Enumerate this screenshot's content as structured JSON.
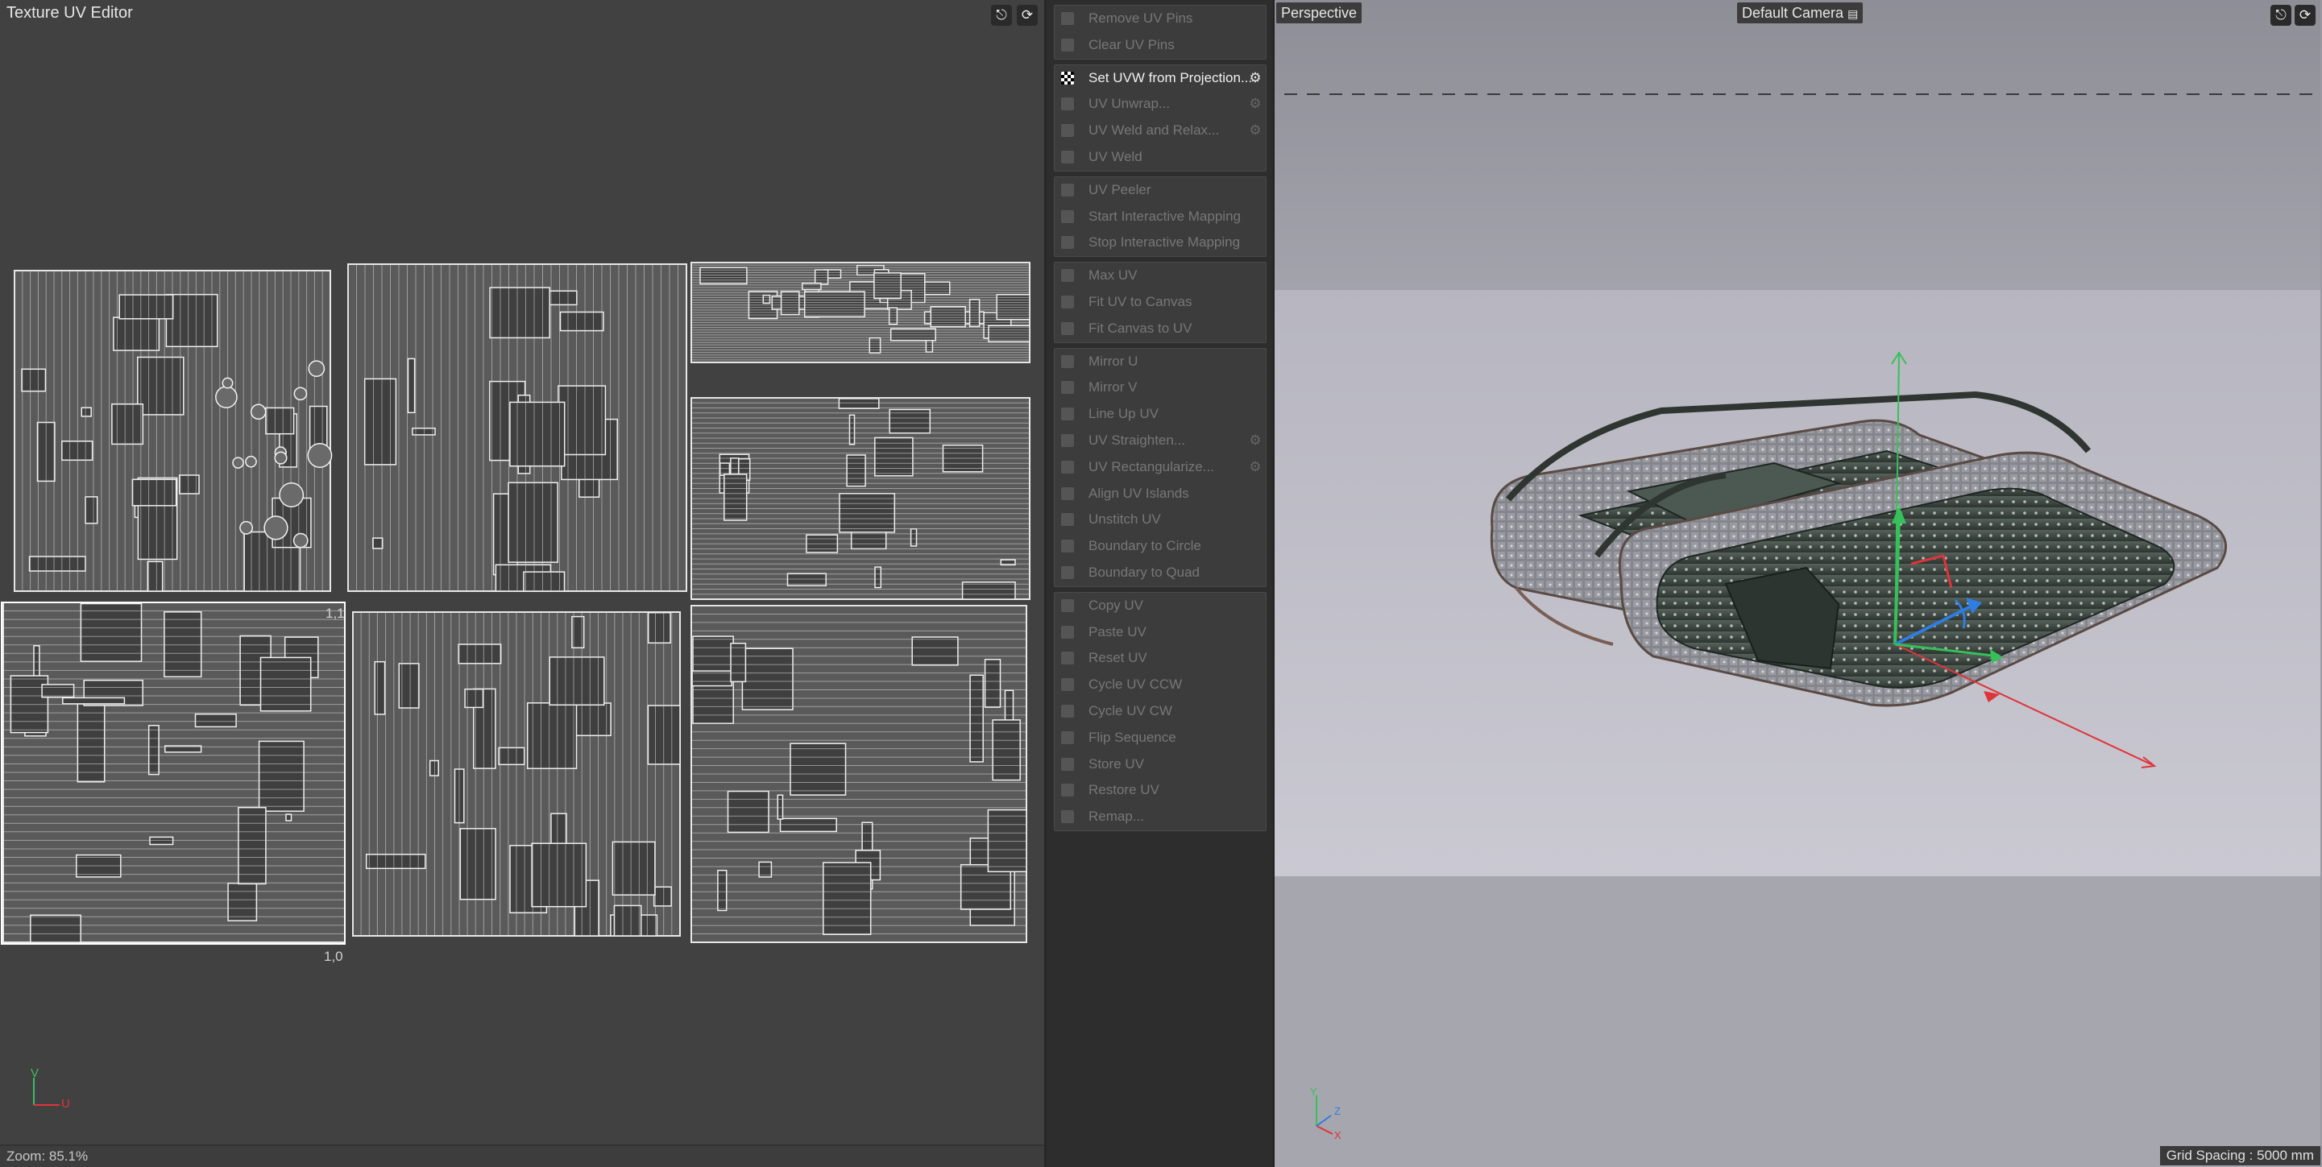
{
  "uv_editor": {
    "title": "Texture UV Editor",
    "tile_label_top": "1,1",
    "tile_label_bottom": "1,0",
    "axis_v": "V",
    "axis_u": "U",
    "zoom": "Zoom: 85.1%",
    "icons": [
      "microphone-icon",
      "refresh-icon"
    ]
  },
  "menu": {
    "groups": [
      [
        {
          "label": "Remove UV Pins",
          "active": false,
          "gear": false
        },
        {
          "label": "Clear UV Pins",
          "active": false,
          "gear": false
        }
      ],
      [
        {
          "label": "Set UVW from Projection...",
          "active": true,
          "gear": true
        },
        {
          "label": "UV Unwrap...",
          "active": false,
          "gear": true
        },
        {
          "label": "UV Weld and Relax...",
          "active": false,
          "gear": true
        },
        {
          "label": "UV Weld",
          "active": false,
          "gear": false
        }
      ],
      [
        {
          "label": "UV Peeler",
          "active": false,
          "gear": false
        },
        {
          "label": "Start Interactive Mapping",
          "active": false,
          "gear": false
        },
        {
          "label": "Stop Interactive Mapping",
          "active": false,
          "gear": false
        }
      ],
      [
        {
          "label": "Max UV",
          "active": false,
          "gear": false
        },
        {
          "label": "Fit UV to Canvas",
          "active": false,
          "gear": false
        },
        {
          "label": "Fit Canvas to UV",
          "active": false,
          "gear": false
        }
      ],
      [
        {
          "label": "Mirror U",
          "active": false,
          "gear": false
        },
        {
          "label": "Mirror V",
          "active": false,
          "gear": false
        },
        {
          "label": "Line Up UV",
          "active": false,
          "gear": false
        },
        {
          "label": "UV Straighten...",
          "active": false,
          "gear": true
        },
        {
          "label": "UV Rectangularize...",
          "active": false,
          "gear": true
        },
        {
          "label": "Align UV Islands",
          "active": false,
          "gear": false
        },
        {
          "label": "Unstitch UV",
          "active": false,
          "gear": false
        },
        {
          "label": "Boundary to Circle",
          "active": false,
          "gear": false
        },
        {
          "label": "Boundary to Quad",
          "active": false,
          "gear": false
        }
      ],
      [
        {
          "label": "Copy UV",
          "active": false,
          "gear": false
        },
        {
          "label": "Paste UV",
          "active": false,
          "gear": false
        },
        {
          "label": "Reset UV",
          "active": false,
          "gear": false
        },
        {
          "label": "Cycle UV CCW",
          "active": false,
          "gear": false
        },
        {
          "label": "Cycle UV CW",
          "active": false,
          "gear": false
        },
        {
          "label": "Flip Sequence",
          "active": false,
          "gear": false
        },
        {
          "label": "Store UV",
          "active": false,
          "gear": false
        },
        {
          "label": "Restore UV",
          "active": false,
          "gear": false
        },
        {
          "label": "Remap...",
          "active": false,
          "gear": false
        }
      ]
    ]
  },
  "viewport": {
    "view_name": "Perspective",
    "camera": "Default Camera",
    "grid_spacing": "Grid Spacing : 5000 mm",
    "axis_x": "X",
    "axis_y": "Y",
    "axis_z": "Z"
  },
  "colors": {
    "axis_x": "#e0343a",
    "axis_y": "#36c05a",
    "axis_z": "#2f7de0",
    "tank_body": "#3f4a44",
    "track": "#8a8a90"
  }
}
